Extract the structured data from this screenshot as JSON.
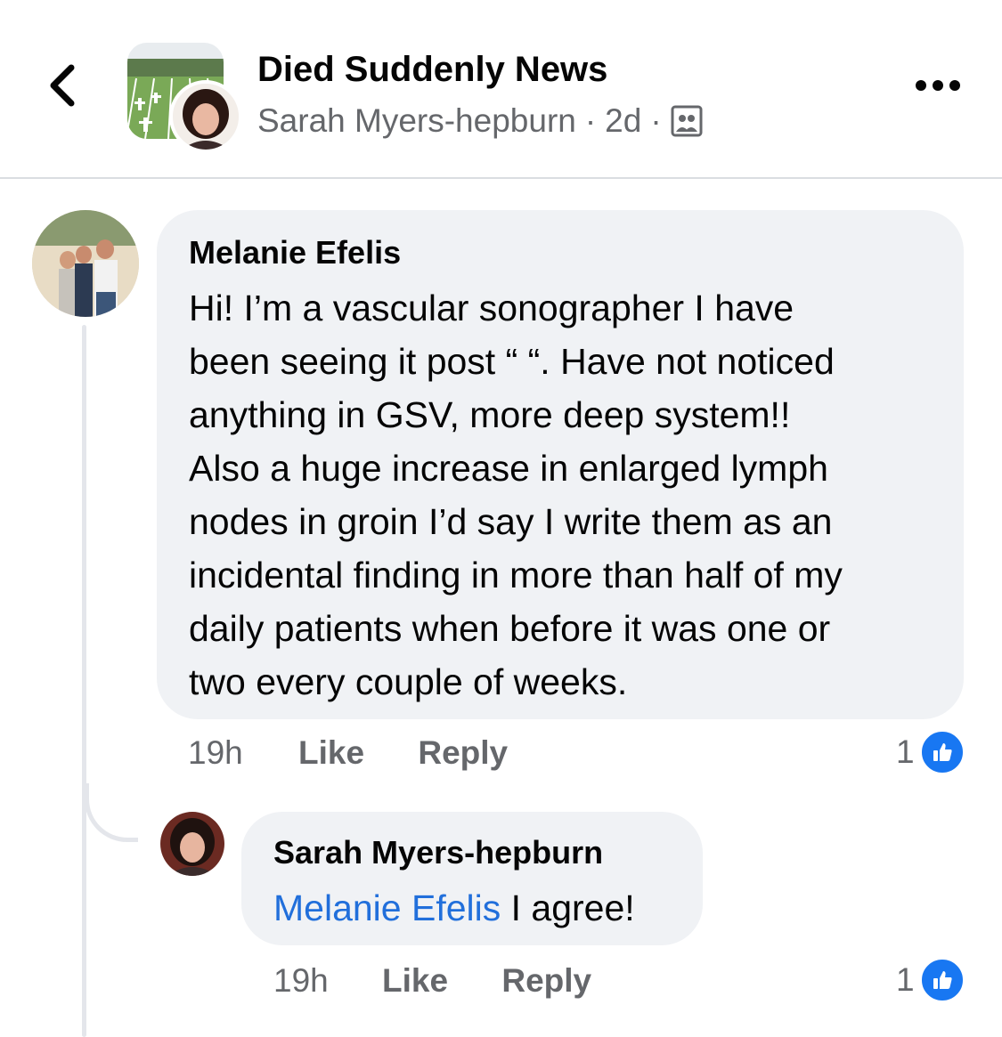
{
  "header": {
    "back_icon": "chevron-left-icon",
    "group_name": "Died Suddenly News",
    "poster_name": "Sarah Myers-hepburn",
    "separator": "·",
    "post_age": "2d",
    "audience_icon": "group-members-icon",
    "more_icon": "more-horizontal-icon"
  },
  "comments": [
    {
      "author": "Melanie Efelis",
      "text": "Hi! I’m a vascular sonographer I have\nbeen seeing it post “ “.  Have not noticed\nanything in GSV, more deep system!!\nAlso a huge increase in enlarged lymph\nnodes in groin I’d say I write them as an\nincidental finding in more than half of my\ndaily patients when before it was one or\ntwo every couple of weeks.",
      "time": "19h",
      "like_label": "Like",
      "reply_label": "Reply",
      "reaction_count": "1"
    }
  ],
  "replies": [
    {
      "author": "Sarah Myers-hepburn",
      "mention": "Melanie Efelis",
      "text": " I agree!",
      "time": "19h",
      "like_label": "Like",
      "reply_label": "Reply",
      "reaction_count": "1"
    }
  ],
  "colors": {
    "secondary_text": "#65676b",
    "bubble": "#f0f2f5",
    "mention": "#216fdb",
    "like_badge": "#1877f2"
  }
}
